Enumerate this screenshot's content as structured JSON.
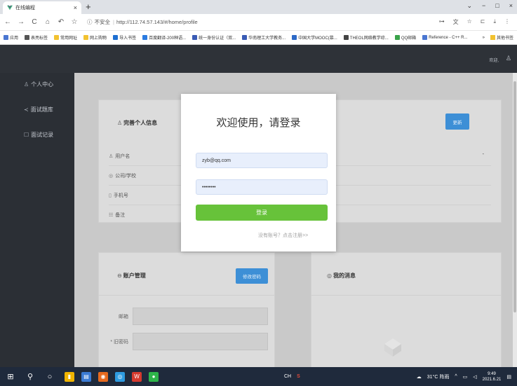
{
  "browser": {
    "tab_title": "在线编程",
    "tab_close": "×",
    "new_tab": "+",
    "window_controls": [
      "⌄",
      "−",
      "□",
      "×"
    ],
    "nav": {
      "back": "←",
      "forward": "→",
      "reload": "C",
      "home": "⌂",
      "undo": "↶",
      "star": "☆"
    },
    "security_icon": "ⓘ",
    "insecure_label": "不安全",
    "separator": "|",
    "url": "http://112.74.57.143/#/home/profile",
    "right_icons": [
      "⊶",
      "文",
      "☆",
      "⊏",
      "⤓",
      "⋮"
    ],
    "bookmarks": [
      {
        "label": "应用",
        "color": "#4a76d1"
      },
      {
        "label": "表亮标签",
        "color": "#555555"
      },
      {
        "label": "常用网址",
        "color": "#f2c230"
      },
      {
        "label": "网上购物",
        "color": "#f2c230"
      },
      {
        "label": "导入书签",
        "color": "#1e6fd1"
      },
      {
        "label": "百度翻译-200种语...",
        "color": "#2b7be0"
      },
      {
        "label": "统一身份认证（双...",
        "color": "#3a5bb5"
      },
      {
        "label": "华南理工大学教务...",
        "color": "#3a5bb5"
      },
      {
        "label": "中国大学MOOC(慕...",
        "color": "#2d69c7"
      },
      {
        "label": "THEOL网络教学综...",
        "color": "#444444"
      },
      {
        "label": "QQ邮箱",
        "color": "#3aa34a"
      },
      {
        "label": "Reference - C++ R...",
        "color": "#4a76d1"
      }
    ],
    "bookmarks_more": "»",
    "bookmarks_other": "其他书签"
  },
  "app": {
    "welcome": "欢迎,",
    "user_icon": "user-icon",
    "sidebar": [
      {
        "icon": "♙",
        "label": "个人中心"
      },
      {
        "icon": "≺",
        "label": "面试题库"
      },
      {
        "icon": "☐",
        "label": "面试记录"
      }
    ],
    "profile_card": {
      "icon": "♙",
      "title": "完善个人信息",
      "update_button": "更新",
      "fields": [
        {
          "icon": "♙",
          "label": "用户名"
        },
        {
          "icon": "◎",
          "label": "公司/学校"
        },
        {
          "icon": "▯",
          "label": "手机号"
        },
        {
          "icon": "☷",
          "label": "备注"
        }
      ],
      "dropdown_mark": "-"
    },
    "account_card": {
      "icon": "🔒",
      "title": "账户管理",
      "change_password_button": "修改密码",
      "email_label": "邮箱",
      "old_password_label": "* 旧密码"
    },
    "messages_card": {
      "icon": "◎",
      "title": "我的消息"
    }
  },
  "login_modal": {
    "title": "欢迎使用，请登录",
    "email_value": "zyb@qq.com",
    "password_value": "••••••••",
    "login_button": "登录",
    "register_link": "没有账号？点击注册>>"
  },
  "taskbar": {
    "start": "⊞",
    "search": "⚲",
    "cortana": "○",
    "apps": [
      {
        "glyph": "▮",
        "color": "#f0b400"
      },
      {
        "glyph": "▤",
        "color": "#3b7bd4"
      },
      {
        "glyph": "◉",
        "color": "#e66a1f"
      },
      {
        "glyph": "◎",
        "color": "#2e9be0"
      },
      {
        "glyph": "W",
        "color": "#d63a2e"
      },
      {
        "glyph": "●",
        "color": "#2eb54a"
      }
    ],
    "ime": "CH",
    "weather": "31°C 阵雨",
    "time": "9:49",
    "date": "2021.6.21"
  }
}
